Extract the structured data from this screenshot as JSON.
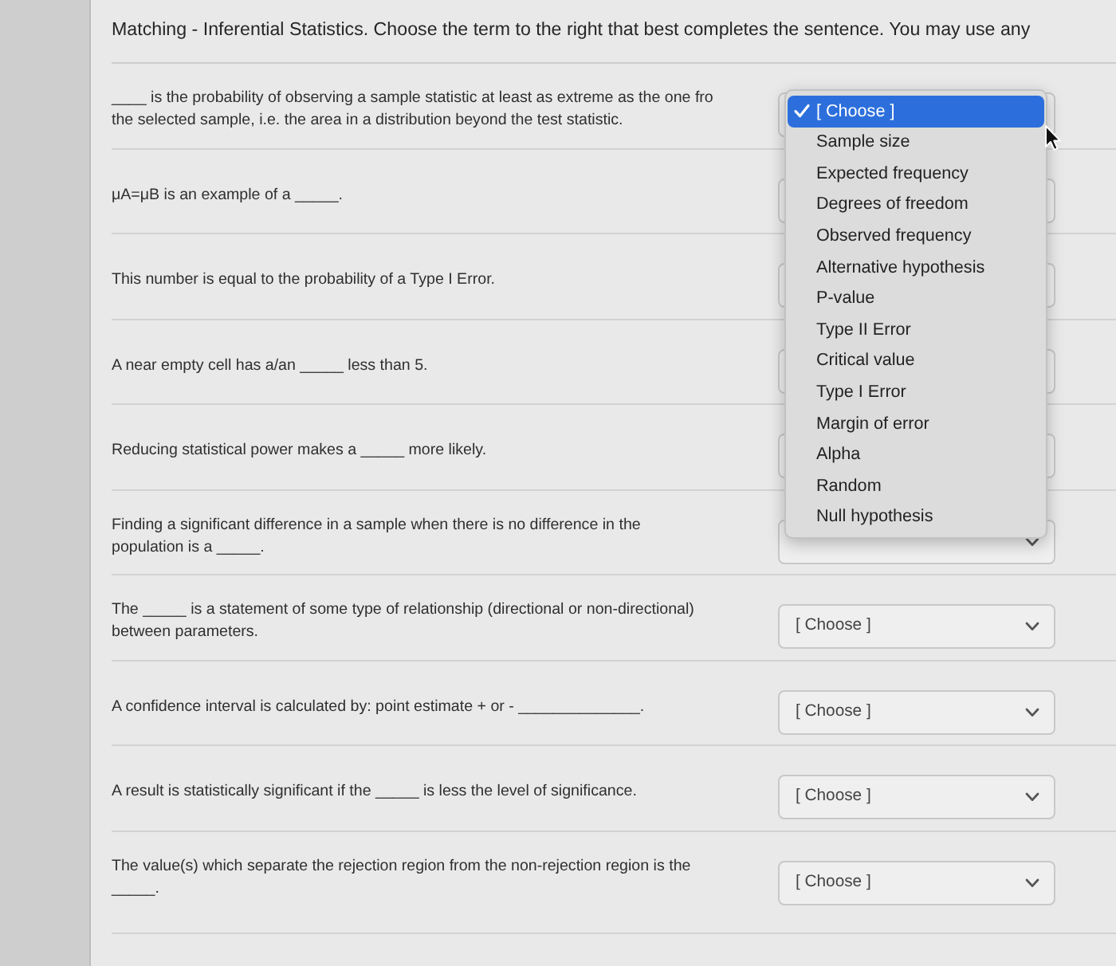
{
  "header": {
    "title": "Matching - Inferential Statistics. Choose the term to the right that best completes the sentence. You may use any"
  },
  "questions": [
    {
      "lines": [
        "____ is the probability of observing a sample statistic at least as extreme as the one fro",
        "the selected sample, i.e. the area in a distribution beyond the test statistic."
      ],
      "menu": {
        "options": [
          {
            "label": "[ Choose ]",
            "selected": true
          },
          {
            "label": "Sample size",
            "selected": false
          },
          {
            "label": "Expected frequency",
            "selected": false
          },
          {
            "label": "Degrees of freedom",
            "selected": false
          },
          {
            "label": "Observed frequency",
            "selected": false
          },
          {
            "label": "Alternative hypothesis",
            "selected": false
          },
          {
            "label": "P-value",
            "selected": false
          },
          {
            "label": "Type II Error",
            "selected": false
          },
          {
            "label": "Critical value",
            "selected": false
          },
          {
            "label": "Type I Error",
            "selected": false
          },
          {
            "label": "Margin of error",
            "selected": false
          },
          {
            "label": "Alpha",
            "selected": false
          },
          {
            "label": "Random",
            "selected": false
          },
          {
            "label": "Null hypothesis",
            "selected": false
          }
        ]
      }
    },
    {
      "lines": [
        "μA=μB is an example of a _____."
      ]
    },
    {
      "lines": [
        "This number is equal to the probability of a Type I Error."
      ]
    },
    {
      "lines": [
        "A near empty cell has a/an _____ less than 5."
      ]
    },
    {
      "lines": [
        "Reducing statistical power makes a _____ more likely."
      ]
    },
    {
      "lines": [
        "Finding a significant difference in a sample when there is no difference in the",
        "population is a _____."
      ]
    },
    {
      "lines": [
        "The _____ is a statement of some type of relationship (directional or non-directional)",
        "between parameters."
      ],
      "choice": "[ Choose ]"
    },
    {
      "lines": [
        "A confidence interval is calculated by: point estimate + or - ______________."
      ],
      "choice": "[ Choose ]"
    },
    {
      "lines": [
        "A result is statistically significant if the _____ is less the level of significance."
      ],
      "choice": "[ Choose ]"
    },
    {
      "lines": [
        "The value(s) which separate the rejection region from the non-rejection region is the",
        "_____."
      ],
      "choice": "[ Choose ]"
    }
  ]
}
